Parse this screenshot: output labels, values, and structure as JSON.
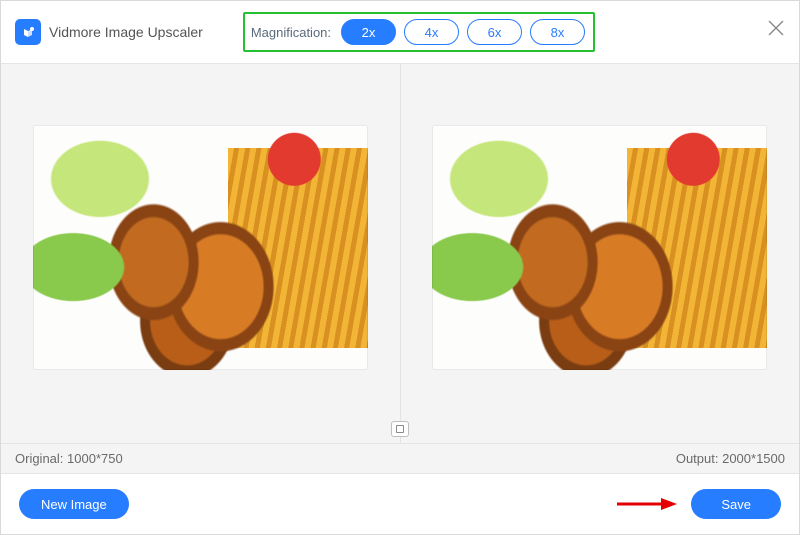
{
  "header": {
    "app_title": "Vidmore Image Upscaler",
    "magnification_label": "Magnification:",
    "options": [
      "2x",
      "4x",
      "6x",
      "8x"
    ],
    "selected_index": 0
  },
  "info": {
    "original_label": "Original: 1000*750",
    "output_label": "Output: 2000*1500"
  },
  "footer": {
    "new_image_label": "New Image",
    "save_label": "Save"
  }
}
